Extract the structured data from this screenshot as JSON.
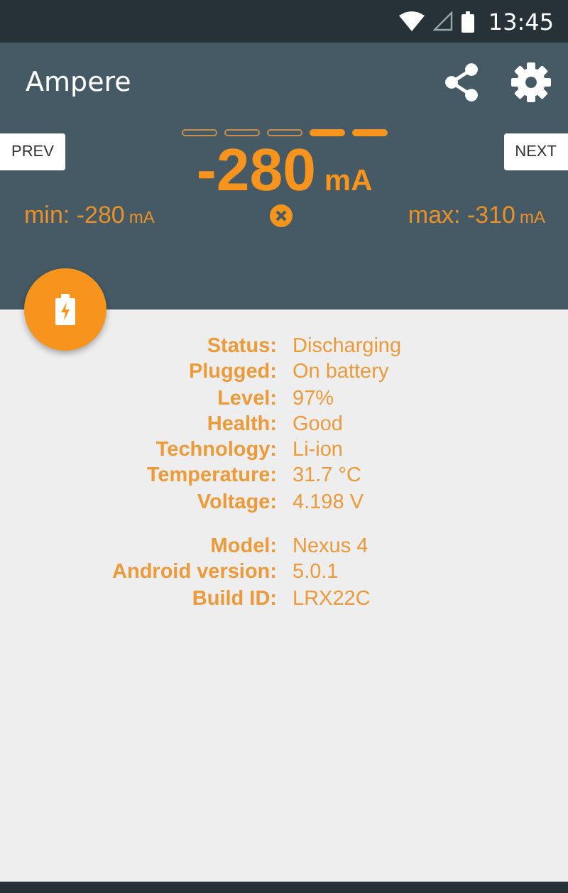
{
  "status_bar": {
    "time": "13:45"
  },
  "toolbar": {
    "title": "Ampere"
  },
  "indicator": [
    {
      "filled": false
    },
    {
      "filled": false
    },
    {
      "filled": false
    },
    {
      "filled": true
    },
    {
      "filled": true
    }
  ],
  "prev_button": "PREV",
  "next_button": "NEXT",
  "current": {
    "value": "-280",
    "unit": "mA"
  },
  "min": {
    "label": "min: -280",
    "unit": "mA"
  },
  "max": {
    "label": "max: -310",
    "unit": "mA"
  },
  "info_groups": [
    [
      {
        "label": "Status:",
        "value": "Discharging"
      },
      {
        "label": "Plugged:",
        "value": "On battery"
      },
      {
        "label": "Level:",
        "value": "97%"
      },
      {
        "label": "Health:",
        "value": "Good"
      },
      {
        "label": "Technology:",
        "value": "Li-ion"
      },
      {
        "label": "Temperature:",
        "value": "31.7 °C"
      },
      {
        "label": "Voltage:",
        "value": "4.198 V"
      }
    ],
    [
      {
        "label": "Model:",
        "value": "Nexus 4"
      },
      {
        "label": "Android version:",
        "value": "5.0.1"
      },
      {
        "label": "Build ID:",
        "value": "LRX22C"
      }
    ]
  ]
}
